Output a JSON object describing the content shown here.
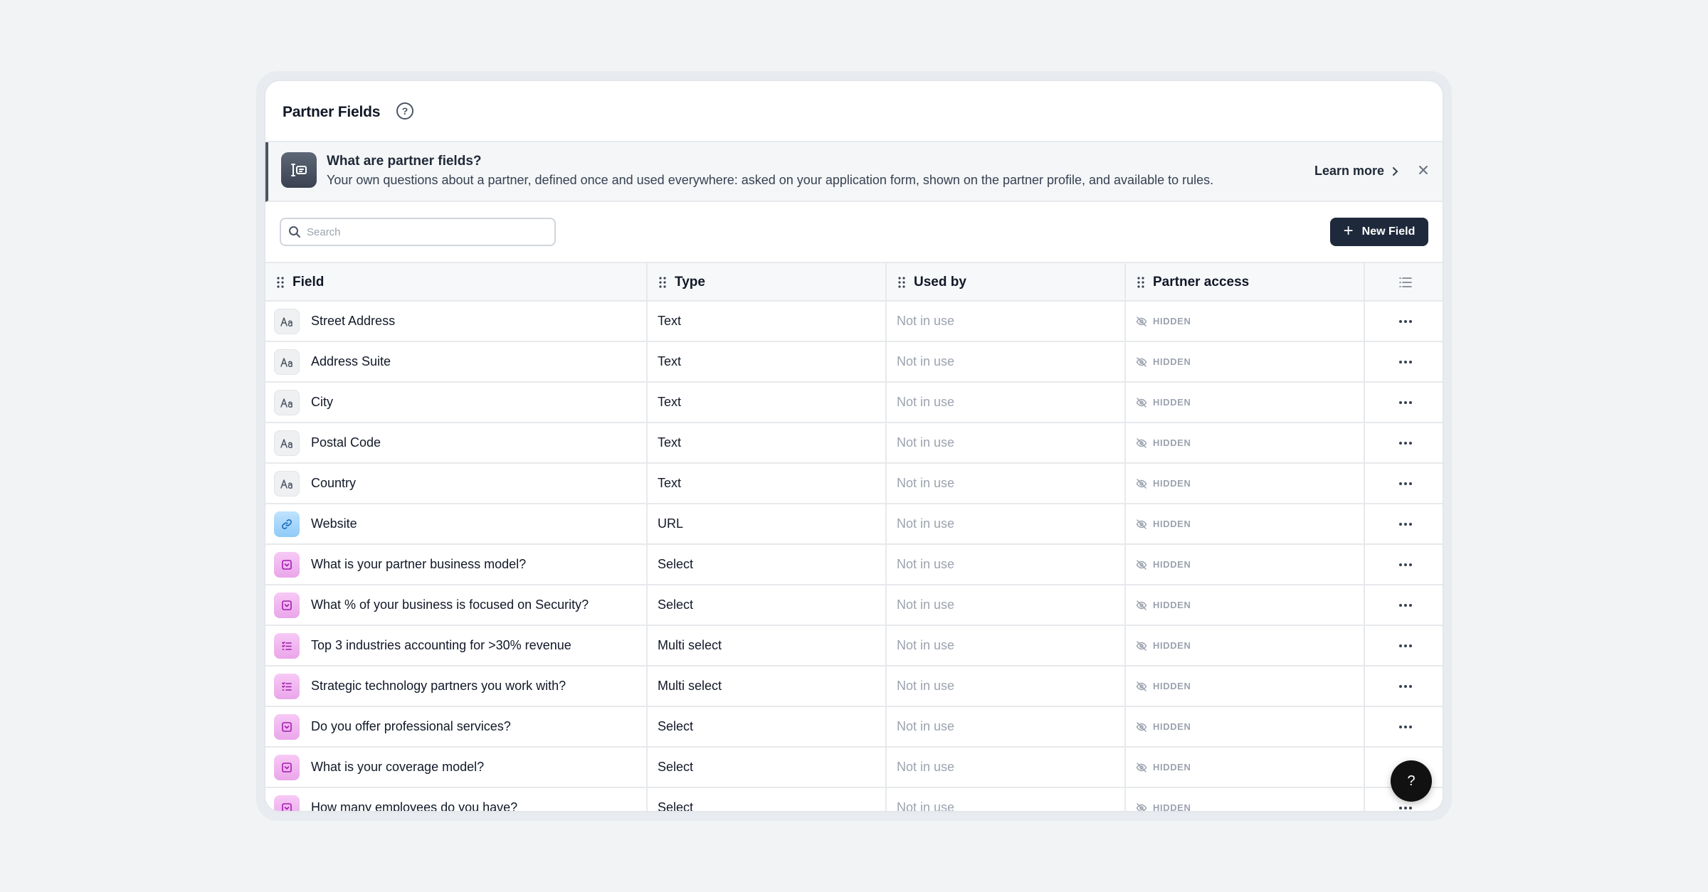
{
  "header": {
    "title": "Partner Fields",
    "help_icon": "question-circle-icon"
  },
  "banner": {
    "icon": "fields-icon",
    "title": "What are partner fields?",
    "text": "Your own questions about a partner, defined once and used everywhere: asked on your application form, shown on the partner profile, and available to rules.",
    "learn_more": "Learn more"
  },
  "toolbar": {
    "search_placeholder": "Search",
    "new_field_label": "New Field"
  },
  "table": {
    "columns": [
      "Field",
      "Type",
      "Used by",
      "Partner access"
    ],
    "rows": [
      {
        "field": "Street Address",
        "icon": "text",
        "type": "Text",
        "used_by": "Not in use",
        "access": "HIDDEN"
      },
      {
        "field": "Address Suite",
        "icon": "text",
        "type": "Text",
        "used_by": "Not in use",
        "access": "HIDDEN"
      },
      {
        "field": "City",
        "icon": "text",
        "type": "Text",
        "used_by": "Not in use",
        "access": "HIDDEN"
      },
      {
        "field": "Postal Code",
        "icon": "text",
        "type": "Text",
        "used_by": "Not in use",
        "access": "HIDDEN"
      },
      {
        "field": "Country",
        "icon": "text",
        "type": "Text",
        "used_by": "Not in use",
        "access": "HIDDEN"
      },
      {
        "field": "Website",
        "icon": "url",
        "type": "URL",
        "used_by": "Not in use",
        "access": "HIDDEN"
      },
      {
        "field": "What is your partner business model?",
        "icon": "select",
        "type": "Select",
        "used_by": "Not in use",
        "access": "HIDDEN"
      },
      {
        "field": "What % of your business is focused on Security?",
        "icon": "select",
        "type": "Select",
        "used_by": "Not in use",
        "access": "HIDDEN"
      },
      {
        "field": "Top 3 industries accounting for >30% revenue",
        "icon": "multiselect",
        "type": "Multi select",
        "used_by": "Not in use",
        "access": "HIDDEN"
      },
      {
        "field": "Strategic technology partners you work with?",
        "icon": "multiselect",
        "type": "Multi select",
        "used_by": "Not in use",
        "access": "HIDDEN"
      },
      {
        "field": "Do you offer professional services?",
        "icon": "select",
        "type": "Select",
        "used_by": "Not in use",
        "access": "HIDDEN"
      },
      {
        "field": "What is your coverage model?",
        "icon": "select",
        "type": "Select",
        "used_by": "Not in use",
        "access": "HIDDEN"
      },
      {
        "field": "How many employees do you have?",
        "icon": "select",
        "type": "Select",
        "used_by": "Not in use",
        "access": "HIDDEN"
      }
    ]
  },
  "help_fab": {
    "label": "?"
  },
  "colors": {
    "primary_button": "#1e293b",
    "muted_text": "#9ca3af",
    "select_icon_bg": "#eaa6ea",
    "url_icon_bg": "#8fcaf7"
  }
}
